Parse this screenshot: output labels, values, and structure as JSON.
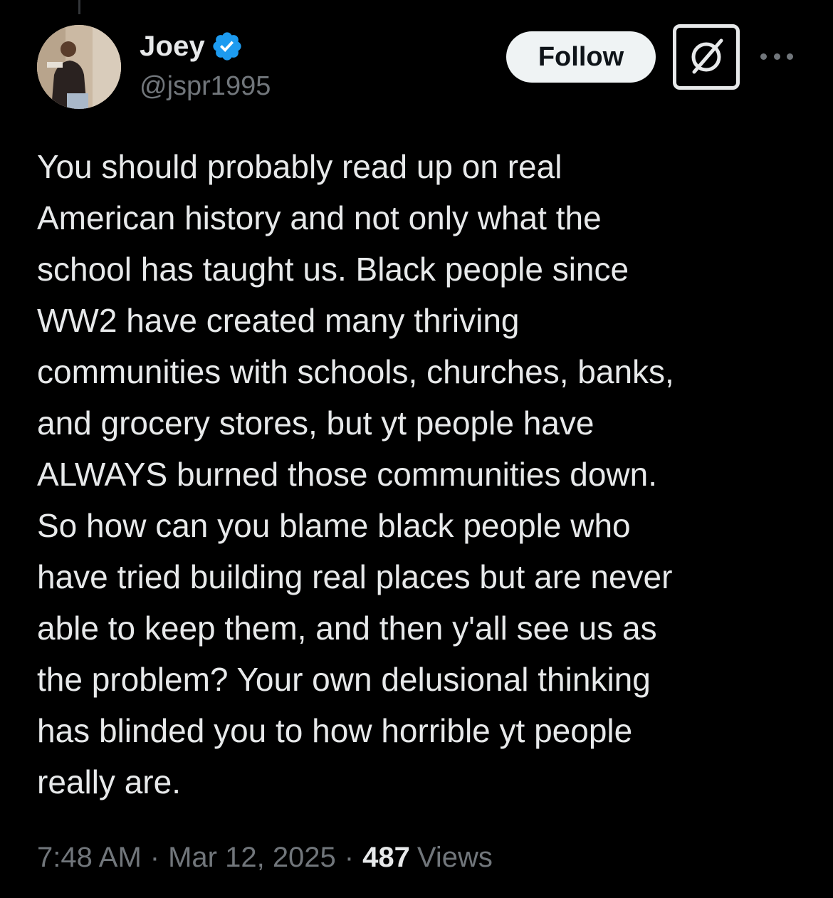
{
  "author": {
    "display_name": "Joey",
    "handle": "@jspr1995",
    "verified": true,
    "verified_color": "#1d9bf0"
  },
  "actions": {
    "follow_label": "Follow",
    "grok_icon": "grok-icon",
    "more_icon": "more-icon"
  },
  "tweet": {
    "text": "You should probably read up on real\nAmerican history and not only what the\nschool has taught us. Black people since\nWW2 have created many thriving\ncommunities with schools, churches, banks,\nand grocery stores, but yt people have\nALWAYS burned those communities down.\nSo how can you blame black people who\nhave tried building real places but are never\nable to keep them, and then y'all see us as\nthe problem? Your own delusional thinking\nhas blinded you to how horrible yt people\nreally are."
  },
  "meta": {
    "time": "7:48 AM",
    "separator": "·",
    "date": "Mar 12, 2025",
    "views_count": "487",
    "views_label": "Views"
  },
  "colors": {
    "background": "#000000",
    "text": "#e7e9ea",
    "secondary": "#71767b",
    "follow_bg": "#eff3f4"
  }
}
